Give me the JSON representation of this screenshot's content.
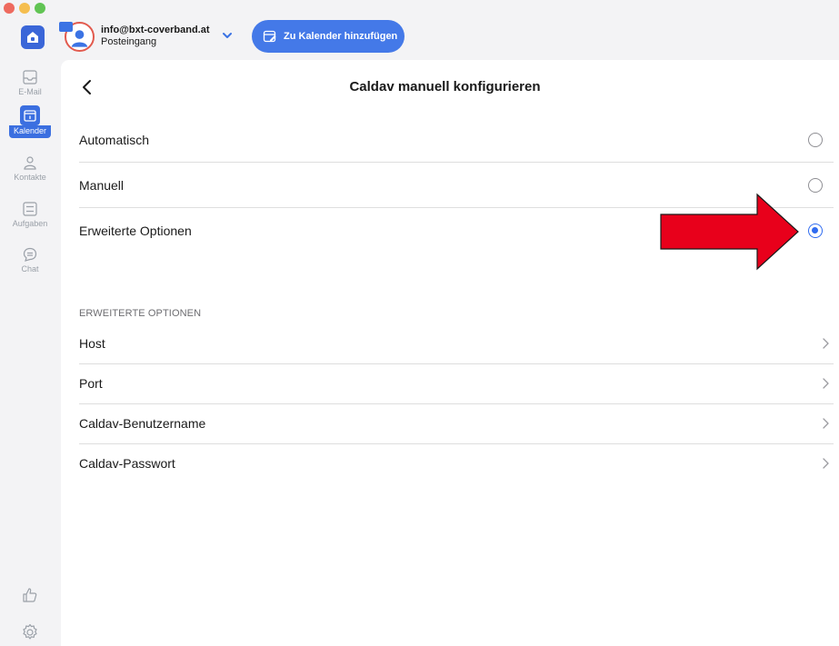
{
  "window": {
    "traffic_lights": [
      "#ee6a5f",
      "#f5be4f",
      "#61c454"
    ]
  },
  "header": {
    "account_email": "info@bxt-coverband.at",
    "account_folder": "Posteingang",
    "add_calendar_label": "Zu Kalender hinzufügen",
    "accent_color": "#4479e8"
  },
  "sidebar": {
    "items": [
      {
        "label": "E-Mail",
        "icon": "inbox-icon",
        "active": false
      },
      {
        "label": "Kalender",
        "icon": "calendar-icon",
        "active": true
      },
      {
        "label": "Kontakte",
        "icon": "contacts-icon",
        "active": false
      },
      {
        "label": "Aufgaben",
        "icon": "tasks-icon",
        "active": false
      },
      {
        "label": "Chat",
        "icon": "chat-icon",
        "active": false
      }
    ],
    "bottom_icons": [
      "thumbs-up-icon",
      "settings-gear-icon"
    ]
  },
  "main": {
    "title": "Caldav manuell konfigurieren",
    "options": [
      {
        "label": "Automatisch",
        "selected": false
      },
      {
        "label": "Manuell",
        "selected": false
      },
      {
        "label": "Erweiterte Optionen",
        "selected": true
      }
    ],
    "section_header": "ERWEITERTE OPTIONEN",
    "fields": [
      {
        "label": "Host"
      },
      {
        "label": "Port"
      },
      {
        "label": "Caldav-Benutzername"
      },
      {
        "label": "Caldav-Passwort"
      }
    ]
  },
  "annotation": {
    "arrow_color": "#e8001b",
    "arrow_target": "Erweiterte Optionen radio"
  }
}
